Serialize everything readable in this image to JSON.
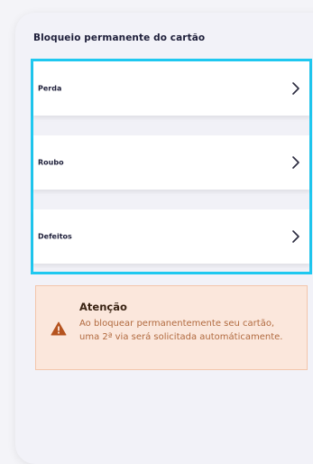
{
  "screen": {
    "title": "Bloqueio permanente do cartão"
  },
  "options": [
    {
      "label": "Perda"
    },
    {
      "label": "Roubo"
    },
    {
      "label": "Defeitos"
    }
  ],
  "alert": {
    "title": "Atenção",
    "message": "Ao bloquear permanentemente seu cartão, uma 2ª via será solicitada automáticamente."
  },
  "colors": {
    "highlight_border": "#1fc8f0",
    "alert_background": "#fbe7dc",
    "alert_text": "#b16a3f",
    "warning_icon": "#b5531f"
  }
}
